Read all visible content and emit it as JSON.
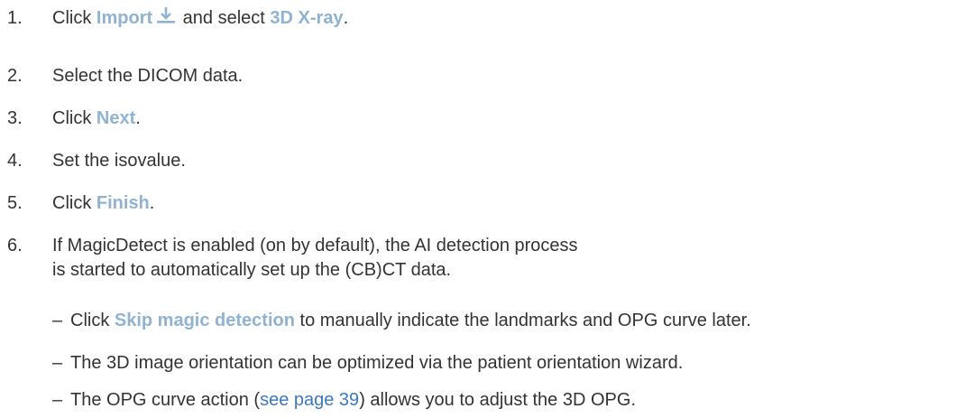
{
  "steps": [
    {
      "num": "1.",
      "pre": "Click ",
      "ui1": "Import",
      "mid": " and select ",
      "ui2": "3D X-ray",
      "post": "."
    },
    {
      "num": "2.",
      "text": "Select the DICOM data."
    },
    {
      "num": "3.",
      "pre": "Click ",
      "ui": "Next",
      "post": "."
    },
    {
      "num": "4.",
      "text": "Set the isovalue."
    },
    {
      "num": "5.",
      "pre": "Click ",
      "ui": "Finish",
      "post": "."
    },
    {
      "num": "6.",
      "line1": "If MagicDetect is enabled (on by default), the AI detection process",
      "line2": "is started to automatically set up the (CB)CT data."
    }
  ],
  "bullets": [
    {
      "dash": "–",
      "pre": "Click ",
      "ui": "Skip magic detection",
      "post": " to manually indicate the landmarks and OPG curve later."
    },
    {
      "dash": "–",
      "text": "The 3D image orientation can be optimized via the patient orientation wizard."
    },
    {
      "dash": "–",
      "pre": "The OPG curve action (",
      "link": "see page 39",
      "post": ") allows you to adjust the 3D OPG."
    }
  ],
  "icons": {
    "import": "download-icon",
    "import_color": "#8fb3d1"
  }
}
